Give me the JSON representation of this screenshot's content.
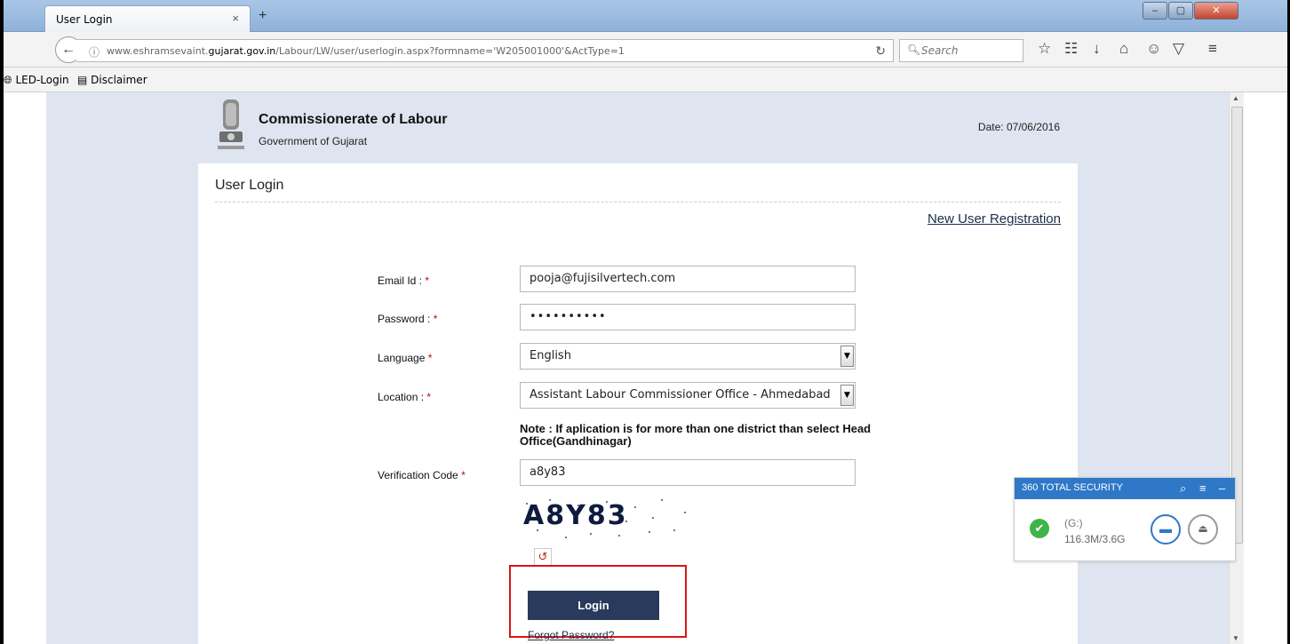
{
  "browser": {
    "tab_title": "User Login",
    "tab_close": "×",
    "new_tab": "+",
    "window_min": "–",
    "window_max": "▢",
    "window_close": "✕",
    "url_prefix": "www.eshramsevaint.",
    "url_domain": "gujarat.gov.in",
    "url_suffix": "/Labour/LW/user/userlogin.aspx?formname='W205001000'&ActType=1",
    "search_placeholder": "Search",
    "bookmarks": [
      {
        "label": "LED-Login",
        "icon": "globe-icon"
      },
      {
        "label": "Disclaimer",
        "icon": "page-icon"
      }
    ]
  },
  "header": {
    "org_name": "Commissionerate of Labour",
    "org_sub": "Government of Gujarat",
    "date": "Date: 07/06/2016"
  },
  "page": {
    "title": "User Login",
    "new_user_link": "New User Registration"
  },
  "form": {
    "email_label": "Email Id : ",
    "email_value": "pooja@fujisilvertech.com",
    "password_label": "Password : ",
    "password_value": "••••••••••",
    "language_label": "Language ",
    "language_value": "English",
    "location_label": "Location : ",
    "location_value": "Assistant Labour Commissioner Office - Ahmedabad",
    "required_mark": "*",
    "note": "Note : If aplication is for more than one district than select Head Office(Gandhinagar)",
    "verification_label": "Verification Code ",
    "verification_value": "a8y83",
    "captcha_text": "A8Y83",
    "login_label": "Login",
    "forgot_label": "Forgot Password?"
  },
  "security360": {
    "title": "360 TOTAL SECURITY",
    "drive": "(G:)",
    "size": "116.3M/3.6G"
  },
  "colors": {
    "accent_blue": "#2f78c8",
    "login_button": "#2a3a5c",
    "highlight_red": "#d91515",
    "page_bg": "#dfe5f0"
  }
}
